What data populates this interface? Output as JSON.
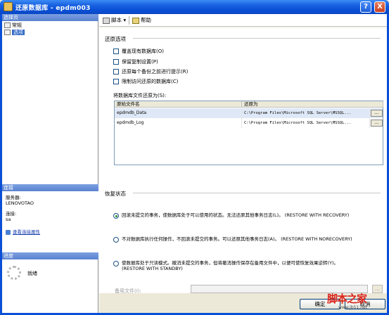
{
  "window": {
    "title": "还原数据库 - epdm003",
    "help_glyph": "?",
    "close_glyph": "X",
    "icon": "database-icon"
  },
  "left_pane": {
    "select_page_header": "选择页",
    "tree": [
      {
        "label": "常规",
        "icon": "page-icon"
      },
      {
        "label": "选项",
        "icon": "page-icon",
        "selected": true
      }
    ],
    "connection_header": "连接",
    "server_label": "服务器:",
    "server_value": "LENOVOTAO",
    "connection_label": "连接:",
    "connection_value": "sa",
    "view_conn_props": "查看连接属性",
    "progress_header": "进度",
    "progress_status": "就绪"
  },
  "toolbar": {
    "script_label": "脚本 ▾",
    "help_label": "帮助"
  },
  "restore_options": {
    "title": "还原选项",
    "checkboxes": [
      {
        "label": "覆盖现有数据库(O)",
        "checked": false
      },
      {
        "label": "保留复制设置(P)",
        "checked": false
      },
      {
        "label": "还原每个备份之前进行提示(R)",
        "checked": false
      },
      {
        "label": "限制访问还原的数据库(C)",
        "checked": false
      }
    ],
    "file_restore_label": "将数据库文件还原为(S):"
  },
  "file_grid": {
    "headers": [
      "原始文件名",
      "还原为"
    ],
    "rows": [
      {
        "original": "epdmdb_Data",
        "restore_as": "C:\\Program Files\\Microsoft SQL Server\\MSSQL..."
      },
      {
        "original": "epdmdb_Log",
        "restore_as": "C:\\Program Files\\Microsoft SQL Server\\MSSQL..."
      }
    ],
    "browse_label": "..."
  },
  "recovery": {
    "title": "恢复状态",
    "options": [
      {
        "label": "回滚未提交的事务，使数据库处于可以使用的状态。无法还原其他事务日志(L)。 (RESTORE WITH RECOVERY)",
        "selected": true
      },
      {
        "label": "不对数据库执行任何操作，不回滚未提交的事务。可以还原其他事务日志(A)。 (RESTORE WITH NORECOVERY)",
        "selected": false
      },
      {
        "label_line1": "使数据库处于只读模式。撤消未提交的事务，但将撤消操作保存在备用文件中，以便可使恢复效果逆转(Y)。",
        "label_line2": "(RESTORE WITH STANDBY)",
        "selected": false
      }
    ],
    "standby_label": "备用文件(I):",
    "standby_value": "",
    "browse_label": "..."
  },
  "buttons": {
    "ok": "确定",
    "cancel": "取消"
  },
  "watermark": {
    "text": "脚本之家",
    "url": "www.jb51.net"
  },
  "colors": {
    "titlebar": "#0a50d6",
    "selection": "#316ac5",
    "link": "#1a40b0"
  }
}
